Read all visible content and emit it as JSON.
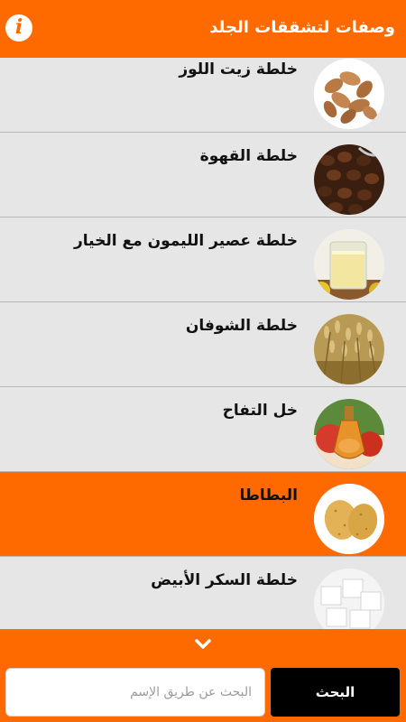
{
  "header": {
    "title": "وصفات لتشققات الجلد",
    "info_icon": "info-icon",
    "info_glyph": "i",
    "accent_color": "#ff6a00"
  },
  "recipes": [
    {
      "label": "خلطة زيت اللوز",
      "icon": "almonds-image",
      "selected": false
    },
    {
      "label": "خلطة القهوة",
      "icon": "coffee-beans-image",
      "selected": false
    },
    {
      "label": "خلطة عصير الليمون مع الخيار",
      "icon": "lemon-juice-glass-image",
      "selected": false
    },
    {
      "label": "خلطة الشوفان",
      "icon": "oats-image",
      "selected": false
    },
    {
      "label": "خل التفاح",
      "icon": "apple-vinegar-image",
      "selected": false
    },
    {
      "label": "البطاطا",
      "icon": "potatoes-image",
      "selected": true
    },
    {
      "label": "خلطة السكر الأبيض",
      "icon": "sugar-cubes-image",
      "selected": false
    }
  ],
  "expander": {
    "icon": "chevron-down-icon"
  },
  "search": {
    "placeholder": "البحث عن طريق الإسم",
    "value": "",
    "button_label": "البحث"
  }
}
